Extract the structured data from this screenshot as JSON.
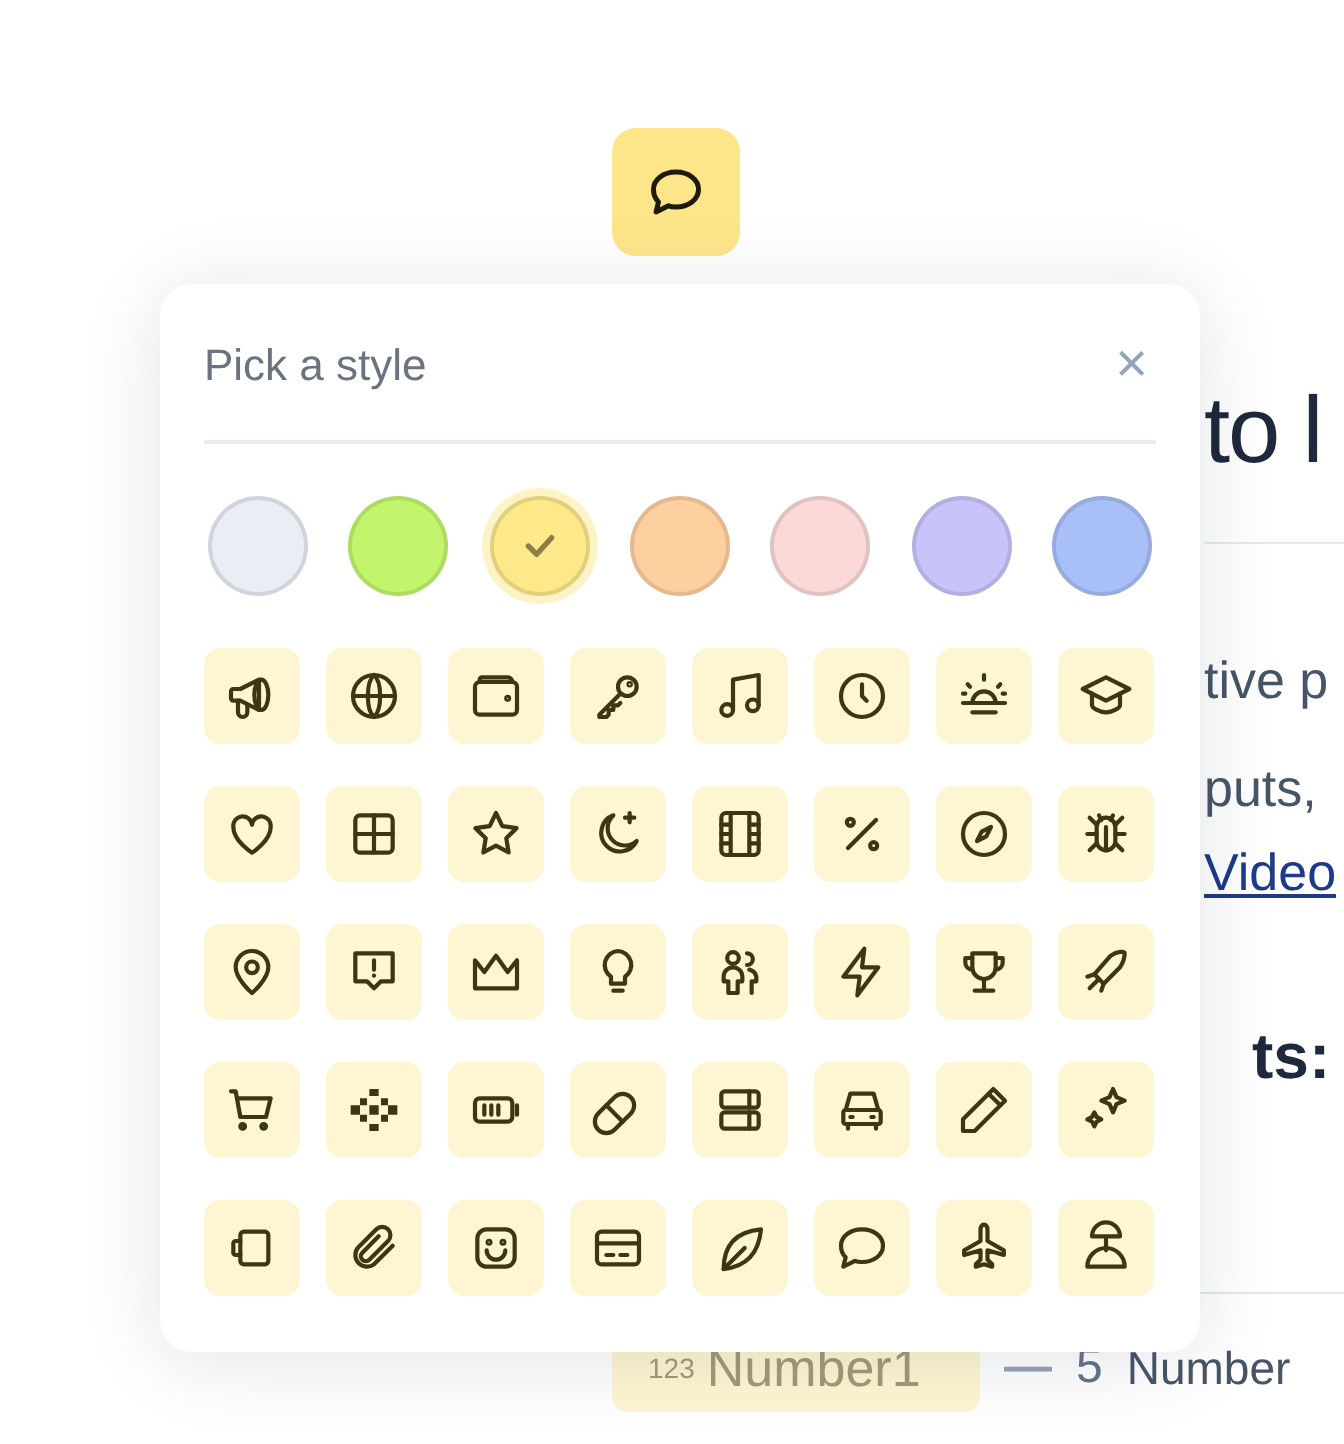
{
  "page": {
    "heading": "to l",
    "paragraph_lines": [
      "tive p",
      "puts,"
    ],
    "link": "Video",
    "subheading": "ts:",
    "row": {
      "chip_icon": "123",
      "chip_label": "Number1",
      "dash": "—",
      "value": "5",
      "label": "Number"
    }
  },
  "popover": {
    "title": "Pick a style",
    "close": "×"
  },
  "swatches": [
    {
      "color": "#e9edf5",
      "selected": false
    },
    {
      "color": "#c2f56b",
      "selected": false
    },
    {
      "color": "#fde88a",
      "selected": true
    },
    {
      "color": "#fecf9f",
      "selected": false
    },
    {
      "color": "#fad9d8",
      "selected": false
    },
    {
      "color": "#c8c3fb",
      "selected": false
    },
    {
      "color": "#a9bff8",
      "selected": false
    }
  ]
}
